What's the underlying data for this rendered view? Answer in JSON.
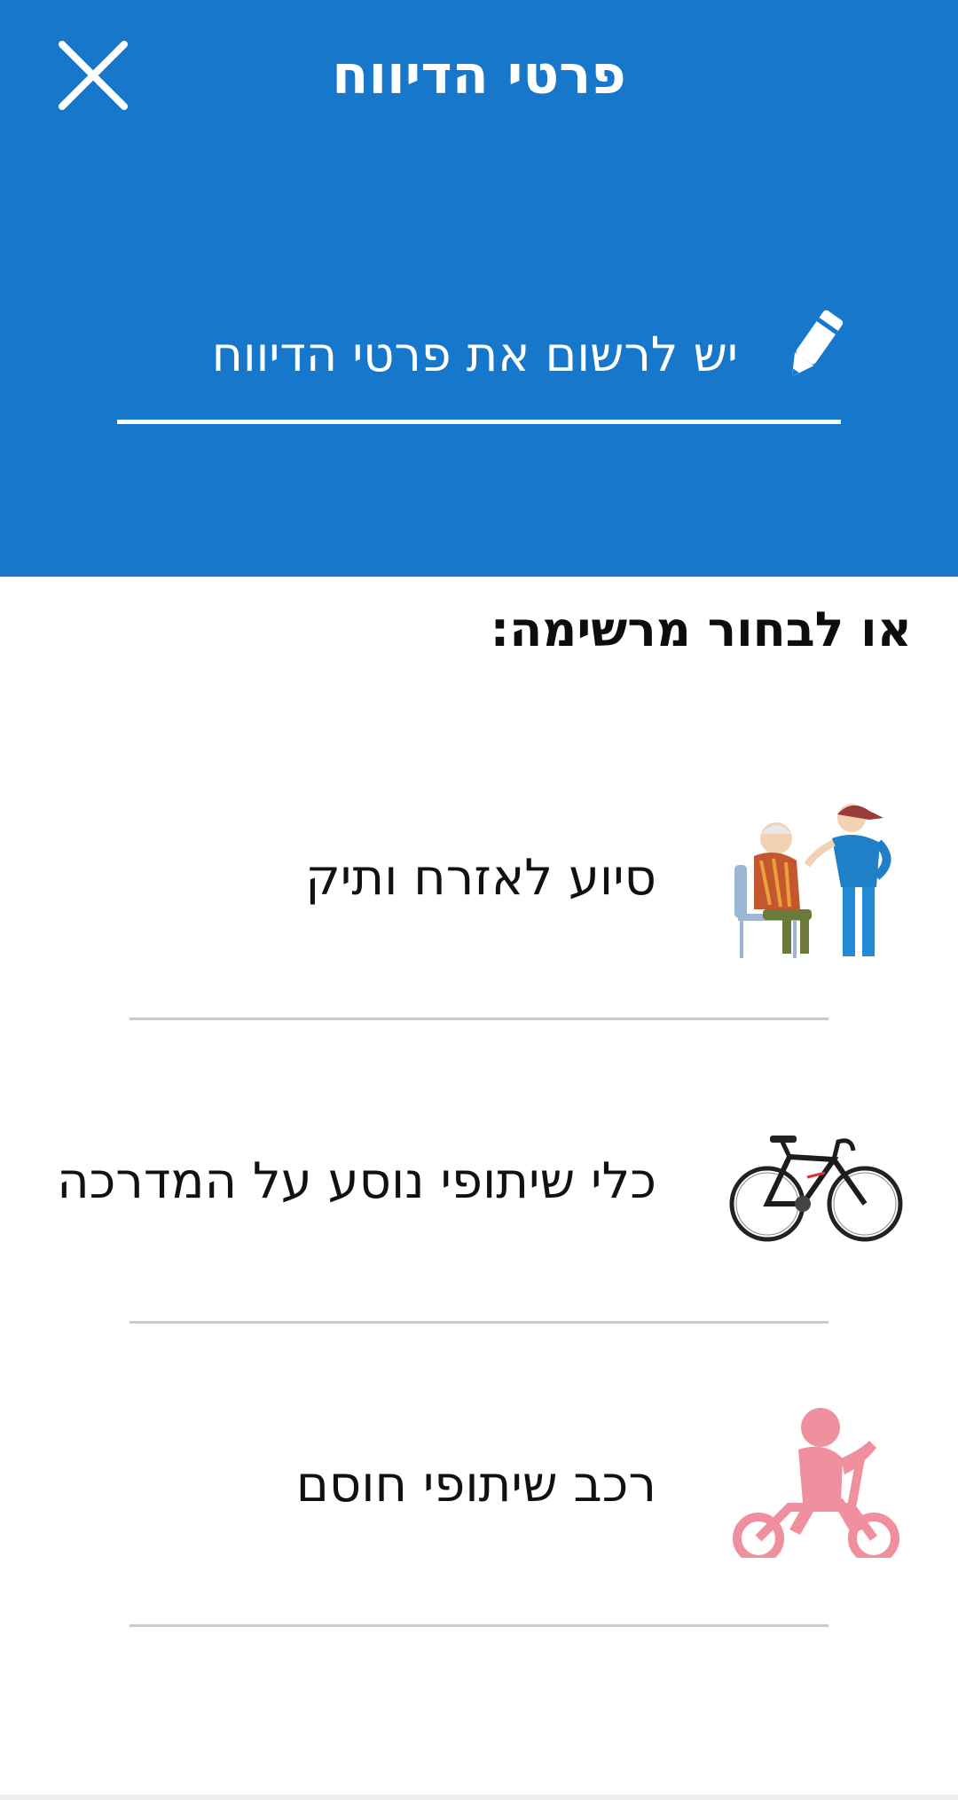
{
  "colors": {
    "header_bg": "#1677cb",
    "divider": "#cccccc"
  },
  "header": {
    "title": "פרטי הדיווח",
    "close_icon": "close-icon"
  },
  "input": {
    "placeholder": "יש לרשום את פרטי הדיווח",
    "icon": "pencil-icon"
  },
  "list": {
    "heading": "או לבחור מרשימה:",
    "items": [
      {
        "label": "סיוע לאזרח ותיק",
        "image": "elderly-assistance-image"
      },
      {
        "label": "כלי שיתופי נוסע על המדרכה",
        "image": "bicycle-image"
      },
      {
        "label": "רכב שיתופי חוסם",
        "image": "child-balance-bike-image"
      }
    ]
  }
}
